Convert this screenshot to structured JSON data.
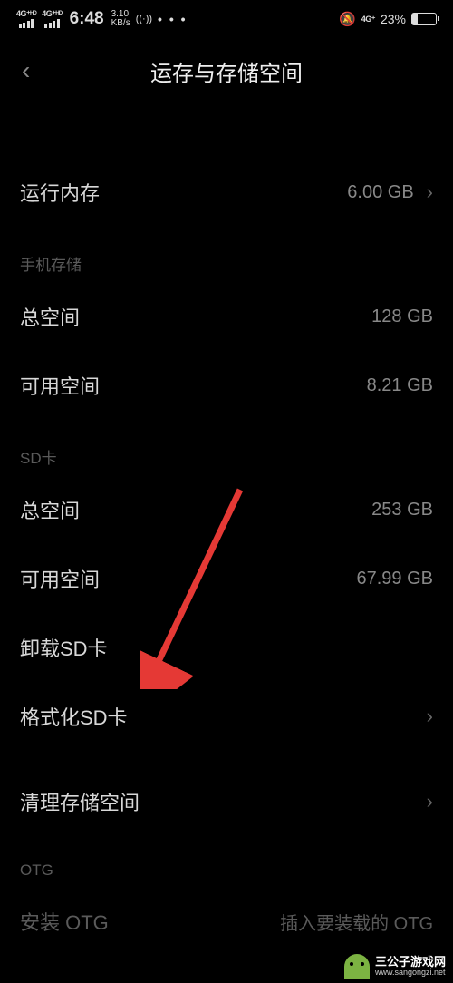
{
  "status": {
    "sig1_label": "4G⁺ᴴᴰ",
    "sig2_label": "4G⁺ᴴᴰ",
    "time": "6:48",
    "speed_top": "3.10",
    "speed_bot": "KB/s",
    "hotspot": "((·))",
    "dots": "• • •",
    "bell": "🔕",
    "net_indicator": "4G⁺",
    "battery_pct": "23%"
  },
  "header": {
    "back": "‹",
    "title": "运存与存储空间"
  },
  "ram": {
    "label": "运行内存",
    "value": "6.00 GB"
  },
  "phone_storage": {
    "header": "手机存储",
    "total_label": "总空间",
    "total_value": "128 GB",
    "avail_label": "可用空间",
    "avail_value": "8.21 GB"
  },
  "sd": {
    "header": "SD卡",
    "total_label": "总空间",
    "total_value": "253 GB",
    "avail_label": "可用空间",
    "avail_value": "67.99 GB",
    "unmount_label": "卸载SD卡",
    "format_label": "格式化SD卡"
  },
  "cleanup": {
    "label": "清理存储空间"
  },
  "otg": {
    "header": "OTG",
    "install_label": "安装 OTG",
    "install_hint": "插入要装载的 OTG"
  },
  "watermark": {
    "cn": "三公子游戏网",
    "url": "www.sangongzi.net"
  },
  "chevron": "›"
}
